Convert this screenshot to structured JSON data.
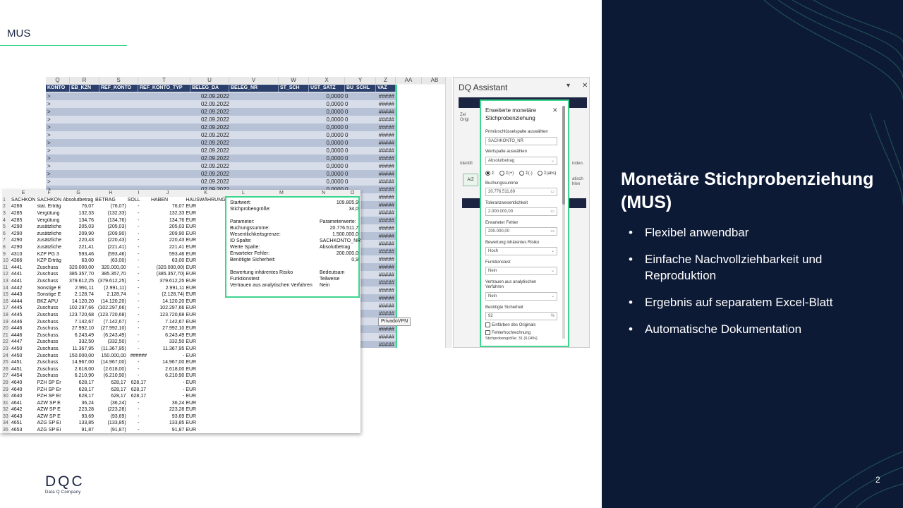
{
  "slide": {
    "tag": "MUS",
    "page_number": "2",
    "logo_mark": "DQC",
    "logo_subtitle": "Data Q Company",
    "title": "Monetäre Stichprobenziehung (MUS)",
    "bullets": [
      "Flexibel anwendbar",
      "Einfache Nachvollziehbarkeit und Reproduktion",
      "Ergebnis auf separatem Excel-Blatt",
      "Automatische Dokumentation"
    ],
    "colors": {
      "dark": "#0d1a36",
      "accent": "#3ed58e",
      "navy": "#1b2440"
    }
  },
  "back_sheet": {
    "column_letters": [
      "Q",
      "R",
      "S",
      "T",
      "U",
      "V",
      "W",
      "X",
      "Y",
      "Z",
      "AA",
      "AB"
    ],
    "header_cells": [
      "KONTO",
      "EB_KZN",
      "REF_KONTO",
      "REF_KONTO_TYP",
      "BELEG_DA",
      "BELEG_NR",
      "ST_SCH",
      "UST_SATZ",
      "BU_SCHL",
      "VAZ"
    ],
    "row_date": "02.09.2022",
    "row_rate": "0,0000",
    "row_code": "0",
    "row_hash": "#####",
    "row_marker": ">"
  },
  "dq_assistant": {
    "title": "DQ Assistant",
    "minimize": "▾",
    "close": "✕",
    "side_left_1": "Zei",
    "side_left_2": "Origi",
    "side_left_3": "Identifi",
    "side_right_1": "inden.",
    "side_right_2": "atisch",
    "side_right_3": "hlen",
    "btn_az": "A/Z"
  },
  "dialog": {
    "title": "Erweiterte monetäre Stichprobenziehung",
    "close": "✕",
    "primary_label": "Primärschlüsselspalte auswählen",
    "primary_value": "SACHKONTO_NR",
    "value_label": "Wertspalte auswählen",
    "value_value": "Absolutbetrag",
    "radio_options": [
      "Σ",
      "Σ(+)",
      "Σ(-)",
      "Σ(abs)"
    ],
    "booking_label": "Buchungssumme",
    "booking_value": "20.776.511,69",
    "tolerance_label": "Toleranzwesentlichkeit",
    "tolerance_value": "2.000.000,00",
    "expected_label": "Erwarteter Fehler",
    "expected_value": "200.000,00",
    "risk_label": "Bewertung inhärentes Risiko",
    "risk_value": "Hoch",
    "function_label": "Funktionstest",
    "function_value": "Nein",
    "trust_label": "Vertrauen aus analytischen Verfahren",
    "trust_value": "Nein",
    "certainty_label": "Benötigte Sicherheit",
    "certainty_value": "92",
    "certainty_unit": "%",
    "check_colour": "Einfärben des Originals",
    "check_extrap": "Fehlerhochrechnung",
    "footer": "Stichprobengröße: 31 (0,04%)"
  },
  "front_sheet": {
    "col_letters": [
      "",
      "E",
      "F",
      "G",
      "H",
      "I",
      "J",
      "K",
      "L",
      "M",
      "N",
      "O"
    ],
    "headers": [
      "SACHKON",
      "SACHKON",
      "Absolutbetrag",
      "BETRAG",
      "SOLL",
      "HABEN",
      "HAUSWÄHRUNG"
    ],
    "rows": [
      [
        "4266",
        "stat. Erträg",
        "76,07",
        "(76,07)",
        "-",
        "76,07",
        "EUR"
      ],
      [
        "4285",
        "Vergütung",
        "132,33",
        "(132,33)",
        "-",
        "132,33",
        "EUR"
      ],
      [
        "4285",
        "Vergütung",
        "134,76",
        "(134,76)",
        "-",
        "134,76",
        "EUR"
      ],
      [
        "4290",
        "zusätzliche",
        "205,03",
        "(205,03)",
        "-",
        "205,03",
        "EUR"
      ],
      [
        "4290",
        "zusätzliche",
        "209,90",
        "(209,90)",
        "-",
        "209,90",
        "EUR"
      ],
      [
        "4290",
        "zusätzliche",
        "220,43",
        "(220,43)",
        "-",
        "220,43",
        "EUR"
      ],
      [
        "4290",
        "zusätzliche",
        "221,41",
        "(221,41)",
        "-",
        "221,41",
        "EUR"
      ],
      [
        "4310",
        "KZP PG 3",
        "593,46",
        "(593,46)",
        "-",
        "593,46",
        "EUR"
      ],
      [
        "4366",
        "KZP Erträg",
        "63,00",
        "(63,00)",
        "-",
        "63,00",
        "EUR"
      ],
      [
        "4441",
        "Zuschuss",
        "320.000,00",
        "320.000,00",
        "-",
        "(320.000,00)",
        "EUR"
      ],
      [
        "4441",
        "Zuschuss",
        "385.357,70",
        "385.357,70",
        "-",
        "(385.357,70)",
        "EUR"
      ],
      [
        "4441",
        "Zuschuss",
        "379.612,25",
        "(379.612,25)",
        "-",
        "379.612,25",
        "EUR"
      ],
      [
        "4442",
        "Sonstige E",
        "2.991,11",
        "(2.991,11)",
        "-",
        "2.991,11",
        "EUR"
      ],
      [
        "4443",
        "Sonstige E",
        "2.128,74",
        "2.128,74",
        "-",
        "(2.128,74)",
        "EUR"
      ],
      [
        "4444",
        "BKZ APU",
        "14.120,20",
        "(14.120,20)",
        "-",
        "14.120,20",
        "EUR"
      ],
      [
        "4445",
        "Zuschuss",
        "102.297,66",
        "(102.297,66)",
        "-",
        "102.297,66",
        "EUR"
      ],
      [
        "4445",
        "Zuschuss",
        "123.720,68",
        "(123.720,68)",
        "-",
        "123.720,68",
        "EUR"
      ],
      [
        "4446",
        "Zuschuss.",
        "7.142,67",
        "(7.142,67)",
        "-",
        "7.142,67",
        "EUR"
      ],
      [
        "4446",
        "Zuschuss.",
        "27.992,10",
        "(27.992,10)",
        "-",
        "27.992,10",
        "EUR"
      ],
      [
        "4446",
        "Zuschuss.",
        "6.243,49",
        "(6.243,49)",
        "-",
        "6.243,49",
        "EUR"
      ],
      [
        "4447",
        "Zuschuss",
        "332,50",
        "(332,50)",
        "-",
        "332,50",
        "EUR"
      ],
      [
        "4450",
        "Zuschuss.",
        "11.367,95",
        "(11.367,95)",
        "-",
        "11.367,95",
        "EUR"
      ],
      [
        "4450",
        "Zuschuss",
        "150.000,00",
        "150.000,00",
        "######",
        "-",
        "EUR"
      ],
      [
        "4451",
        "Zuschuss",
        "14.967,00",
        "(14.967,00)",
        "-",
        "14.967,00",
        "EUR"
      ],
      [
        "4451",
        "Zuschuss",
        "2.618,00",
        "(2.618,00)",
        "-",
        "2.618,00",
        "EUR"
      ],
      [
        "4454",
        "Zuschuss",
        "6.210,90",
        "(6.210,90)",
        "-",
        "6.210,90",
        "EUR"
      ],
      [
        "4640",
        "PZH SP Er",
        "628,17",
        "628,17",
        "628,17",
        "-",
        "EUR"
      ],
      [
        "4640",
        "PZH SP Er",
        "628,17",
        "628,17",
        "628,17",
        "-",
        "EUR"
      ],
      [
        "4640",
        "PZH SP Er",
        "628,17",
        "628,17",
        "628,17",
        "-",
        "EUR"
      ],
      [
        "4641",
        "AZW SP E",
        "36,24",
        "(36,24)",
        "-",
        "36,24",
        "EUR"
      ],
      [
        "4642",
        "AZW SP E",
        "223,28",
        "(223,28)",
        "-",
        "223,28",
        "EUR"
      ],
      [
        "4643",
        "AZW SP E",
        "93,69",
        "(93,69)",
        "-",
        "93,69",
        "EUR"
      ],
      [
        "4651",
        "AZG SP Ei",
        "133,85",
        "(133,85)",
        "-",
        "133,85",
        "EUR"
      ],
      [
        "4653",
        "AZG SP Ei",
        "91,87",
        "(91,87)",
        "-",
        "91,87",
        "EUR"
      ]
    ]
  },
  "summary": {
    "startwert_l": "Startwert:",
    "startwert_v": "109.805,9",
    "size_l": "Stichprobengröße:",
    "size_v": "34,0",
    "param_l": "Parameter:",
    "param_r": "Parameterwerte:",
    "booking_l": "Buchungssumme:",
    "booking_v": "20.776.511,7",
    "material_l": "Wesentlichkeitsgrenze:",
    "material_v": "1.500.000,0",
    "id_l": "ID Spalte:",
    "id_v": "SACHKONTO_NR",
    "value_l": "Werte Spalte:",
    "value_v": "Absolutbetrag",
    "expected_l": "Erwarteter Fehler:",
    "expected_v": "200.000,0",
    "cert_l": "Benötigte Sicherheit:",
    "cert_v": "0,9",
    "risk_l": "Bewertung inhärentes Risiko",
    "risk_v": "Bedeutsam",
    "func_l": "Funktionstest",
    "func_v": "Teilweise",
    "trust_l": "Vertrauen aus analytischen Verfahren",
    "trust_v": "Nein"
  },
  "tooltip": "PrivadoVPN"
}
